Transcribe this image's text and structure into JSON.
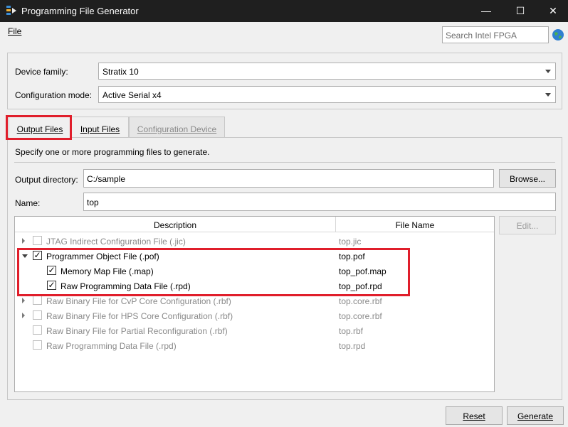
{
  "window": {
    "title": "Programming File Generator",
    "minimize": "—",
    "maximize": "☐",
    "close": "✕"
  },
  "menu": {
    "file": "File"
  },
  "search": {
    "placeholder": "Search Intel FPGA"
  },
  "device": {
    "family_label": "Device family:",
    "family_value": "Stratix 10",
    "config_label": "Configuration mode:",
    "config_value": "Active Serial x4"
  },
  "tabs": [
    {
      "label": "Output Files",
      "state": "active"
    },
    {
      "label": "Input Files",
      "state": "normal"
    },
    {
      "label": "Configuration Device",
      "state": "disabled"
    }
  ],
  "output": {
    "intro": "Specify one or more programming files to generate.",
    "dir_label": "Output directory:",
    "dir_value": "C:/sample",
    "browse": "Browse...",
    "name_label": "Name:",
    "name_value": "top",
    "edit": "Edit..."
  },
  "table": {
    "headers": [
      "Description",
      "File Name"
    ],
    "rows": [
      {
        "desc": "JTAG Indirect Configuration File (.jic)",
        "file": "top.jic",
        "checked": false,
        "enabled": false,
        "expander": "collapsed",
        "level": 0
      },
      {
        "desc": "Programmer Object File (.pof)",
        "file": "top.pof",
        "checked": true,
        "enabled": true,
        "expander": "expanded",
        "level": 0
      },
      {
        "desc": "Memory Map File (.map)",
        "file": "top_pof.map",
        "checked": true,
        "enabled": true,
        "expander": "none",
        "level": 1
      },
      {
        "desc": "Raw Programming Data File (.rpd)",
        "file": "top_pof.rpd",
        "checked": true,
        "enabled": true,
        "expander": "none",
        "level": 1
      },
      {
        "desc": "Raw Binary File for CvP Core Configuration (.rbf)",
        "file": "top.core.rbf",
        "checked": false,
        "enabled": false,
        "expander": "collapsed",
        "level": 0
      },
      {
        "desc": "Raw Binary File for HPS Core Configuration (.rbf)",
        "file": "top.core.rbf",
        "checked": false,
        "enabled": false,
        "expander": "collapsed",
        "level": 0
      },
      {
        "desc": "Raw Binary File for Partial Reconfiguration (.rbf)",
        "file": "top.rbf",
        "checked": false,
        "enabled": false,
        "expander": "none",
        "level": 0
      },
      {
        "desc": "Raw Programming Data File (.rpd)",
        "file": "top.rpd",
        "checked": false,
        "enabled": false,
        "expander": "none",
        "level": 0
      }
    ]
  },
  "footer": {
    "reset": "Reset",
    "generate": "Generate"
  },
  "colors": {
    "titlebar": "#1f1f1f",
    "highlight": "#e01e2b"
  }
}
